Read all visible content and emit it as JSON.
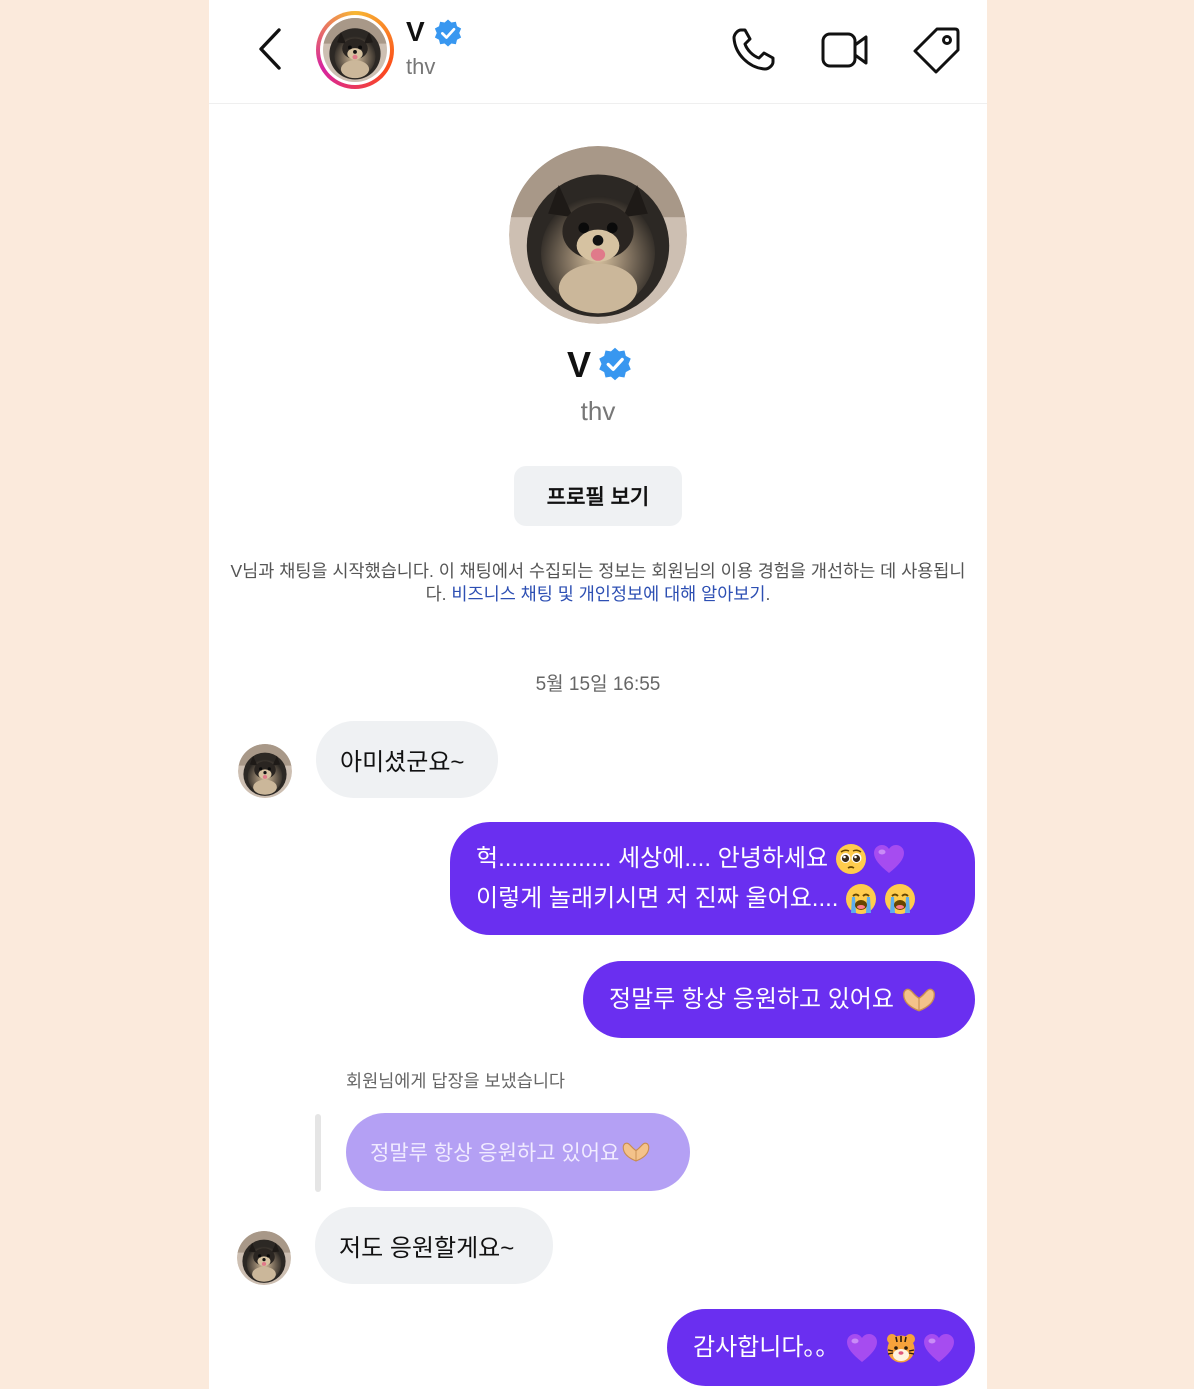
{
  "header": {
    "name": "V",
    "handle": "thv",
    "back_icon": "chevron-left-icon",
    "call_icon": "phone-icon",
    "video_icon": "video-icon",
    "tag_icon": "tag-icon"
  },
  "profile": {
    "name": "V",
    "handle": "thv",
    "view_profile_label": "프로필 보기"
  },
  "notice": {
    "text": "V님과 채팅을 시작했습니다. 이 채팅에서 수집되는 정보는 회원님의 이용 경험을 개선하는 데 사용됩니다.",
    "link": "비즈니스 채팅 및 개인정보에 대해 알아보기",
    "period": "."
  },
  "timestamp": "5월 15일 16:55",
  "messages": [
    {
      "from": "them",
      "text": "아미셨군요~"
    },
    {
      "from": "me",
      "line1": "헉................. 세상에.... 안녕하세요",
      "line2": "이렇게 놀래키시면 저 진짜 울어요...."
    },
    {
      "from": "me",
      "text": "정말루 항상 응원하고 있어요"
    },
    {
      "from": "them",
      "text": "저도 응원할게요~"
    },
    {
      "from": "me",
      "text": "감사합니다。。"
    }
  ],
  "reply": {
    "note": "회원님에게 답장을 보냈습니다",
    "quoted": "정말루 항상 응원하고 있어요"
  },
  "colors": {
    "outgoing_bubble": "#6a2ff0",
    "incoming_bubble": "#eff1f3",
    "page_background": "#fbeadc",
    "verified": "#3897f0",
    "link": "#2d4fb3"
  }
}
